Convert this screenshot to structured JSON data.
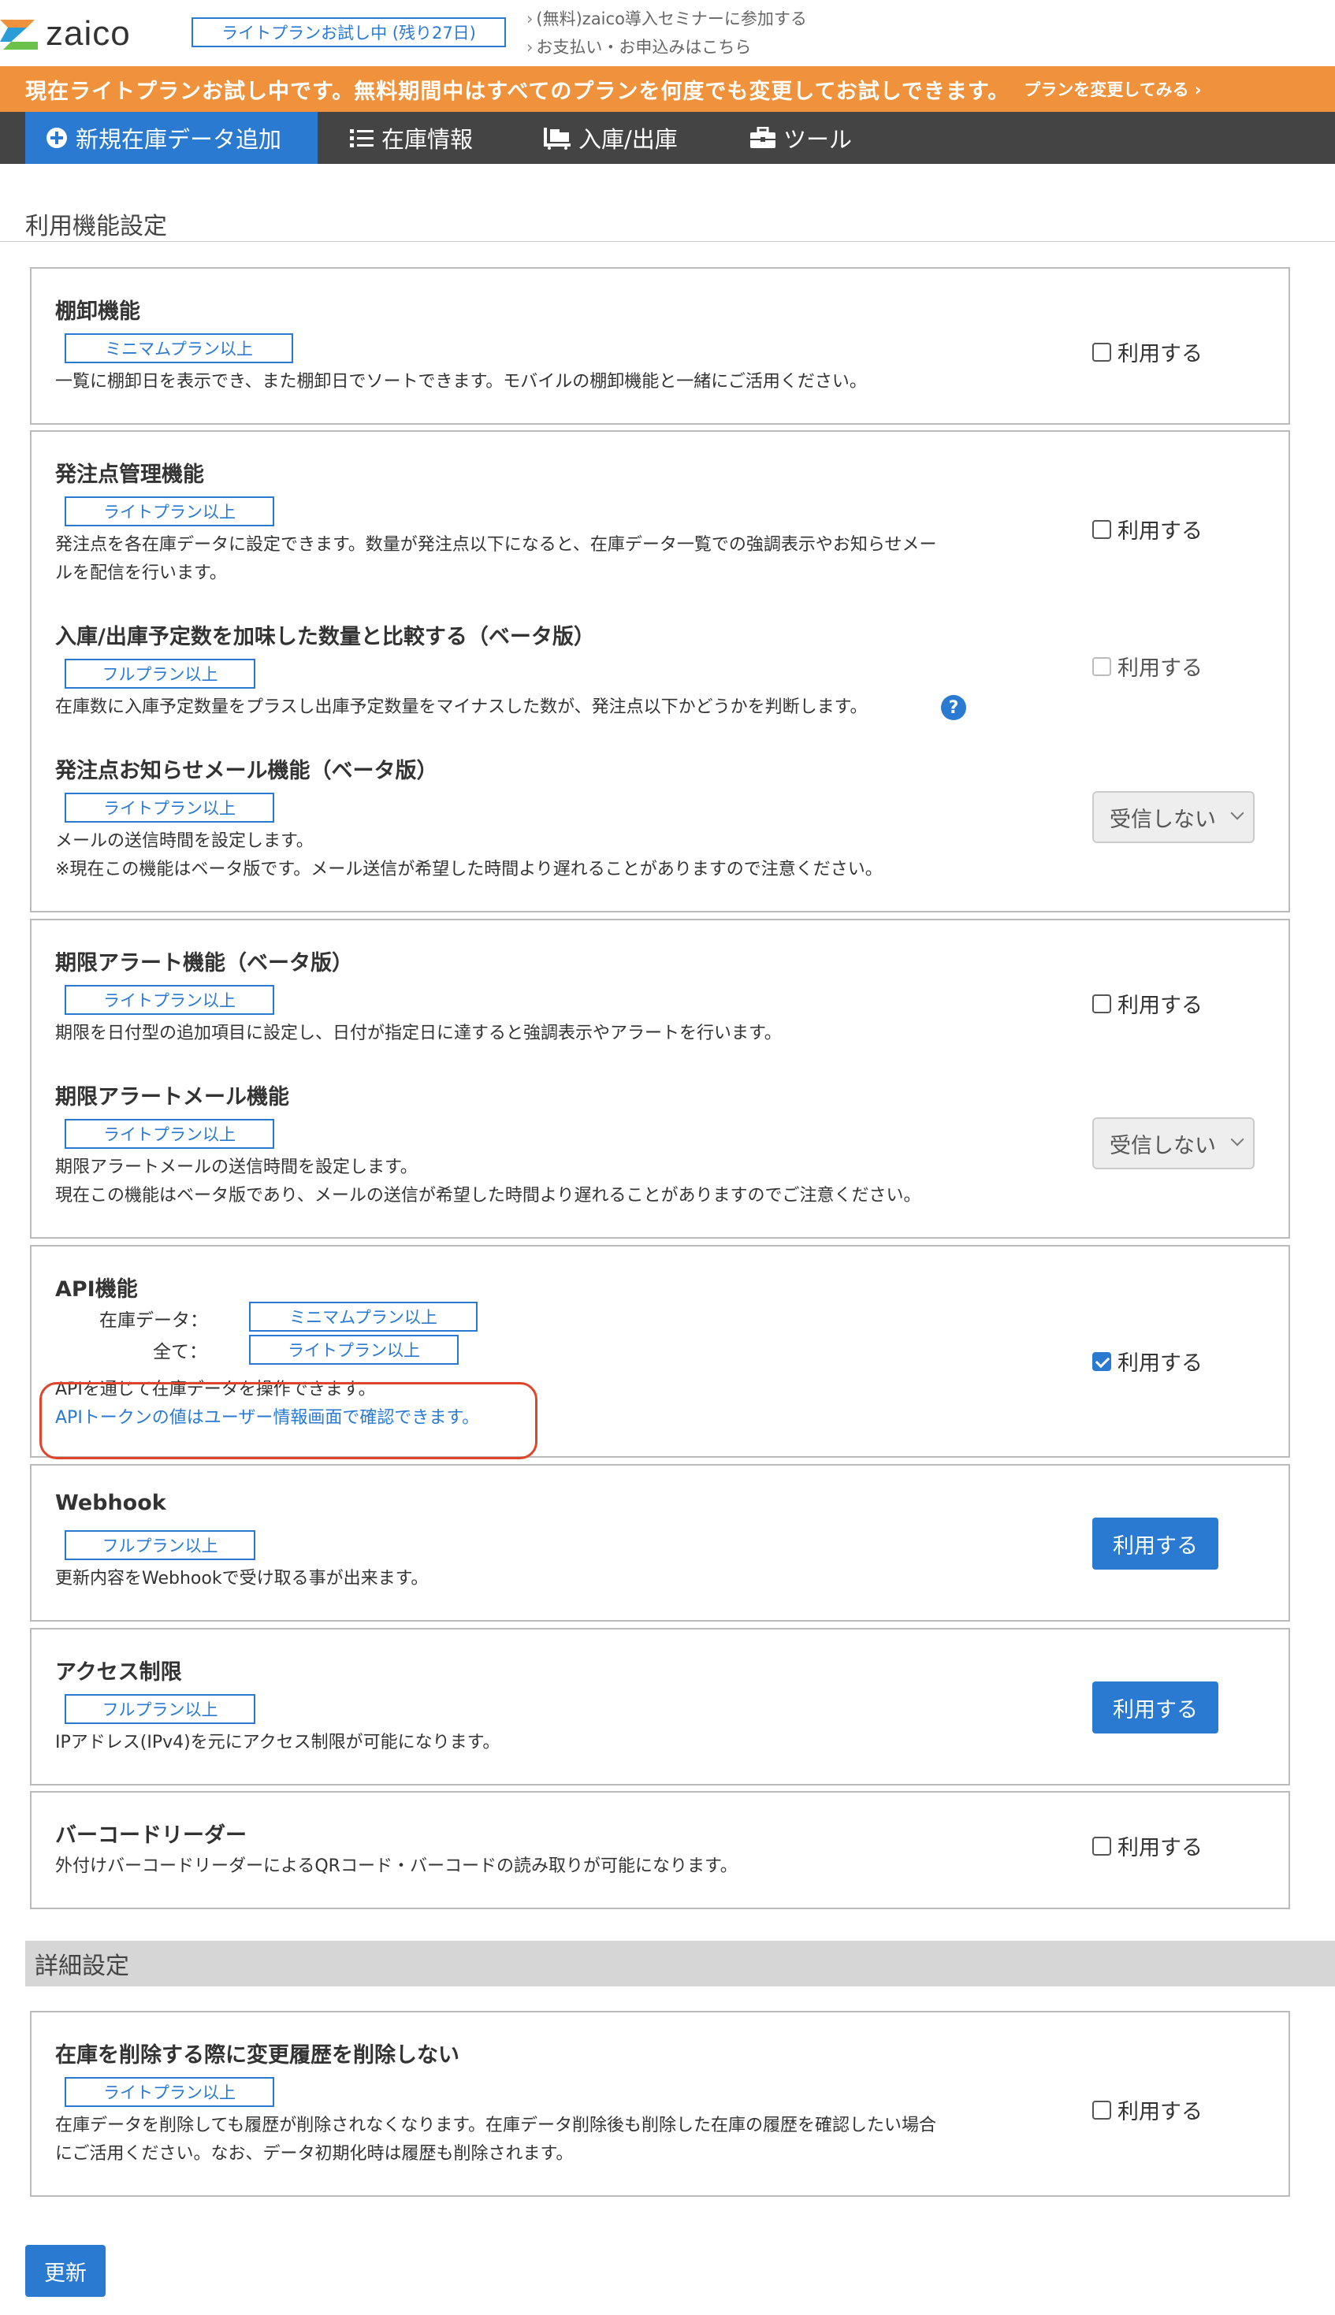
{
  "header": {
    "logo_text": "zaico",
    "trial_badge": "ライトプランお試し中 (残り27日)",
    "links": [
      "(無料)zaico導入セミナーに参加する",
      "お支払い・お申込みはこちら"
    ]
  },
  "banner": {
    "text": "現在ライトプランお試し中です。無料期間中はすべてのプランを何度でも変更してお試しできます。",
    "link": "プランを変更してみる ›"
  },
  "nav": [
    {
      "label": "新規在庫データ追加",
      "icon": "plus-circle-icon"
    },
    {
      "label": "在庫情報",
      "icon": "list-icon"
    },
    {
      "label": "入庫/出庫",
      "icon": "dolly-icon"
    },
    {
      "label": "ツール",
      "icon": "toolbox-icon"
    }
  ],
  "section_title": "利用機能設定",
  "use_label": "利用する",
  "select_value": "受信しない",
  "features": {
    "stocktake": {
      "title": "棚卸機能",
      "plan": "ミニマムプラン以上",
      "desc": "一覧に棚卸日を表示でき、また棚卸日でソートできます。モバイルの棚卸機能と一緒にご活用ください。",
      "checked": false
    },
    "reorder": {
      "title": "発注点管理機能",
      "plan": "ライトプラン以上",
      "desc1": "発注点を各在庫データに設定できます。数量が発注点以下になると、在庫データ一覧での強調表示やお知らせメー",
      "desc2": "ルを配信を行います。",
      "checked": false
    },
    "scheduled": {
      "title": "入庫/出庫予定数を加味した数量と比較する（ベータ版）",
      "plan": "フルプラン以上",
      "desc": "在庫数に入庫予定数量をプラスし出庫予定数量をマイナスした数が、発注点以下かどうかを判断します。",
      "checked": false,
      "disabled": true
    },
    "reorder_mail": {
      "title": "発注点お知らせメール機能（ベータ版）",
      "plan": "ライトプラン以上",
      "desc1": "メールの送信時間を設定します。",
      "desc2": "※現在この機能はベータ版です。メール送信が希望した時間より遅れることがありますので注意ください。"
    },
    "expiry": {
      "title": "期限アラート機能（ベータ版）",
      "plan": "ライトプラン以上",
      "desc": "期限を日付型の追加項目に設定し、日付が指定日に達すると強調表示やアラートを行います。",
      "checked": false
    },
    "expiry_mail": {
      "title": "期限アラートメール機能",
      "plan": "ライトプラン以上",
      "desc1": "期限アラートメールの送信時間を設定します。",
      "desc2": "現在この機能はベータ版であり、メールの送信が希望した時間より遅れることがありますのでご注意ください。"
    },
    "api": {
      "title": "API機能",
      "label1": "在庫データ：",
      "plan1": "ミニマムプラン以上",
      "label2": "全て：",
      "plan2": "ライトプラン以上",
      "desc": "APIを通じて在庫データを操作できます。",
      "link": "APIトークンの値はユーザー情報画面で確認できます。",
      "checked": true
    },
    "webhook": {
      "title": "Webhook",
      "plan": "フルプラン以上",
      "desc": "更新内容をWebhookで受け取る事が出来ます。"
    },
    "access": {
      "title": "アクセス制限",
      "plan": "フルプラン以上",
      "desc": "IPアドレス(IPv4)を元にアクセス制限が可能になります。"
    },
    "barcode": {
      "title": "バーコードリーダー",
      "desc": "外付けバーコードリーダーによるQRコード・バーコードの読み取りが可能になります。",
      "checked": false
    }
  },
  "detail_title": "詳細設定",
  "detail": {
    "title": "在庫を削除する際に変更履歴を削除しない",
    "plan": "ライトプラン以上",
    "desc1": "在庫データを削除しても履歴が削除されなくなります。在庫データ削除後も削除した在庫の履歴を確認したい場合",
    "desc2": "にご活用ください。なお、データ初期化時は履歴も削除されます。",
    "checked": false
  },
  "update_button": "更新",
  "colors": {
    "accent": "#2a7ad1",
    "banner": "#f0913b",
    "nav": "#444444",
    "highlight": "#e0452c"
  }
}
